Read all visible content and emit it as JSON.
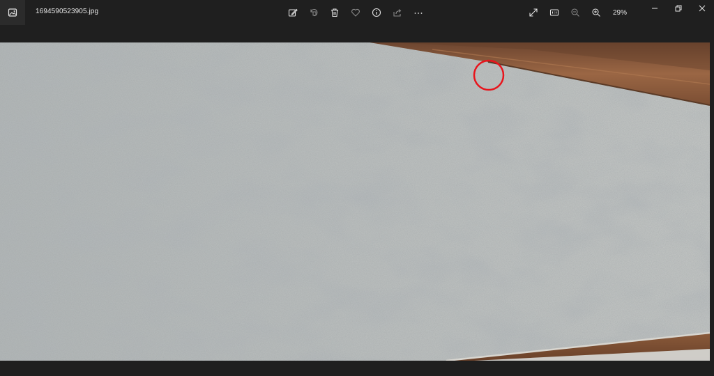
{
  "window": {
    "filename": "1694590523905.jpg",
    "app_icon": "photos-app-icon"
  },
  "toolbar": {
    "items": [
      {
        "name": "edit-image-button",
        "icon": "edit-pen-icon"
      },
      {
        "name": "rotate-button",
        "icon": "rotate-icon"
      },
      {
        "name": "delete-button",
        "icon": "trash-icon"
      },
      {
        "name": "favorite-button",
        "icon": "heart-icon"
      },
      {
        "name": "file-info-button",
        "icon": "info-icon"
      },
      {
        "name": "share-button",
        "icon": "share-icon"
      },
      {
        "name": "more-options-button",
        "icon": "more-icon"
      }
    ],
    "view_items": [
      {
        "name": "full-screen-button",
        "icon": "expand-icon"
      },
      {
        "name": "actual-size-button",
        "icon": "actual-size-icon"
      },
      {
        "name": "zoom-out-button",
        "icon": "zoom-out-icon"
      },
      {
        "name": "zoom-in-button",
        "icon": "zoom-in-icon"
      }
    ],
    "zoom_level": "29%"
  },
  "window_controls": [
    {
      "name": "minimize-button",
      "icon": "minimize-icon"
    },
    {
      "name": "maximize-button",
      "icon": "restore-icon"
    },
    {
      "name": "close-button",
      "icon": "close-icon"
    }
  ],
  "image": {
    "description_colors": {
      "wall": "#b9bdbc",
      "wood": "#8a5a3a",
      "annotation_circle": "#e8141c"
    }
  }
}
